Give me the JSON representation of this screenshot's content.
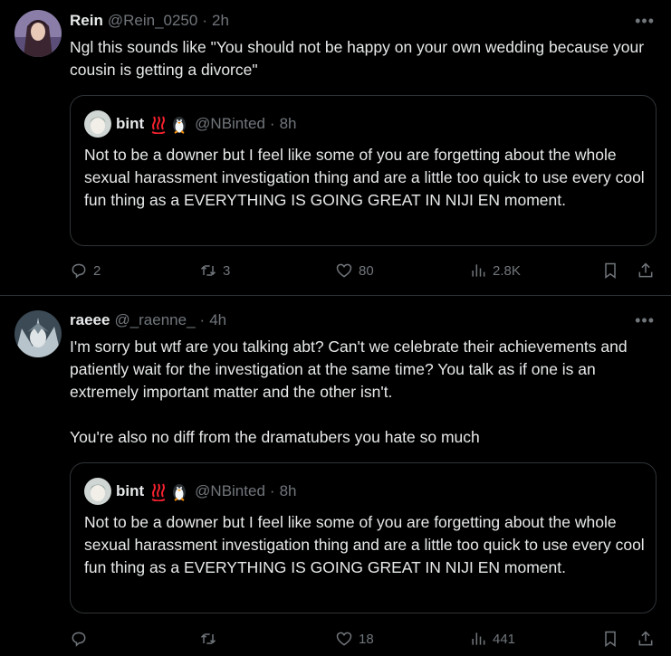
{
  "tweets": [
    {
      "name": "Rein",
      "handle": "@Rein_0250",
      "separator": "·",
      "time": "2h",
      "text": "Ngl this sounds like \"You should not be happy on your own wedding because your cousin is getting a divorce\"",
      "quote": {
        "name": "bint",
        "emoji_1": "♨️",
        "emoji_2": "🐧",
        "handle": "@NBinted",
        "separator": "·",
        "time": "8h",
        "text": "Not to be a downer but I feel like some of you are forgetting about the whole sexual harassment investigation thing and are a little too quick to use every cool fun thing as a EVERYTHING IS GOING GREAT IN NIJI EN moment."
      },
      "stats": {
        "replies": "2",
        "reposts": "3",
        "likes": "80",
        "views": "2.8K"
      }
    },
    {
      "name": "raeee",
      "handle": "@_raenne_",
      "separator": "·",
      "time": "4h",
      "text": "I'm sorry but wtf are you talking abt? Can't we celebrate their achievements and patiently wait for the investigation at the same time? You talk as if one is an extremely important matter and the other isn't.\n\nYou're also no diff from the dramatubers you hate so much",
      "quote": {
        "name": "bint",
        "emoji_1": "♨️",
        "emoji_2": "🐧",
        "handle": "@NBinted",
        "separator": "·",
        "time": "8h",
        "text": "Not to be a downer but I feel like some of you are forgetting about the whole sexual harassment investigation thing and are a little too quick to use every cool fun thing as a EVERYTHING IS GOING GREAT IN NIJI EN moment."
      },
      "stats": {
        "replies": "",
        "reposts": "",
        "likes": "18",
        "views": "441"
      }
    }
  ],
  "more_glyph": "•••",
  "colors": {
    "background": "#000000",
    "text": "#e7e9ea",
    "secondary": "#71767b",
    "border": "#2f3336",
    "hotspring": "#f4212e"
  }
}
